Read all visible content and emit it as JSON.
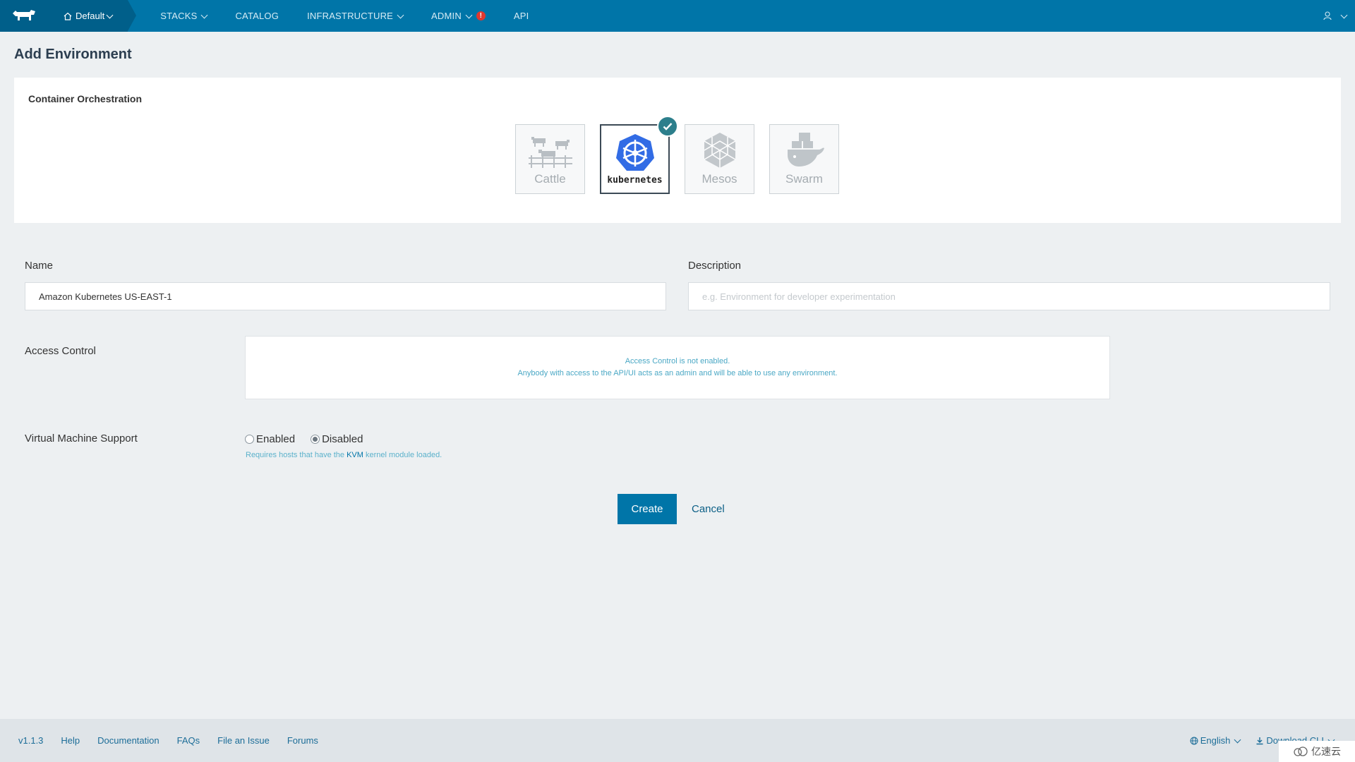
{
  "header": {
    "env_label": "Default",
    "nav": [
      {
        "label": "STACKS"
      },
      {
        "label": "CATALOG"
      },
      {
        "label": "INFRASTRUCTURE"
      },
      {
        "label": "ADMIN"
      },
      {
        "label": "API"
      }
    ],
    "admin_alert": "!",
    "accent_color": "#0075a8"
  },
  "page": {
    "title": "Add Environment"
  },
  "orchestration": {
    "label": "Container Orchestration",
    "options": [
      {
        "label": "Cattle",
        "icon": "cattle-icon",
        "selected": false
      },
      {
        "label": "kubernetes",
        "icon": "kubernetes-icon",
        "selected": true
      },
      {
        "label": "Mesos",
        "icon": "mesos-icon",
        "selected": false
      },
      {
        "label": "Swarm",
        "icon": "swarm-icon",
        "selected": false
      }
    ]
  },
  "form": {
    "name_label": "Name",
    "name_value": "Amazon Kubernetes US-EAST-1",
    "description_label": "Description",
    "description_placeholder": "e.g. Environment for developer experimentation",
    "access_label": "Access Control",
    "access_line1": "Access Control is not enabled.",
    "access_line2": "Anybody with access to the API/UI acts as an admin and will be able to use any environment.",
    "vm_label": "Virtual Machine Support",
    "vm_enabled": "Enabled",
    "vm_disabled": "Disabled",
    "vm_selected": "Disabled",
    "vm_hint_pre": "Requires hosts that have the",
    "vm_hint_kvm": "KVM",
    "vm_hint_post": "kernel module loaded."
  },
  "actions": {
    "create": "Create",
    "cancel": "Cancel"
  },
  "footer": {
    "version": "v1.1.3",
    "links": [
      "Help",
      "Documentation",
      "FAQs",
      "File an Issue",
      "Forums"
    ],
    "language": "English",
    "download": "Download CLI"
  },
  "watermark": "亿速云"
}
